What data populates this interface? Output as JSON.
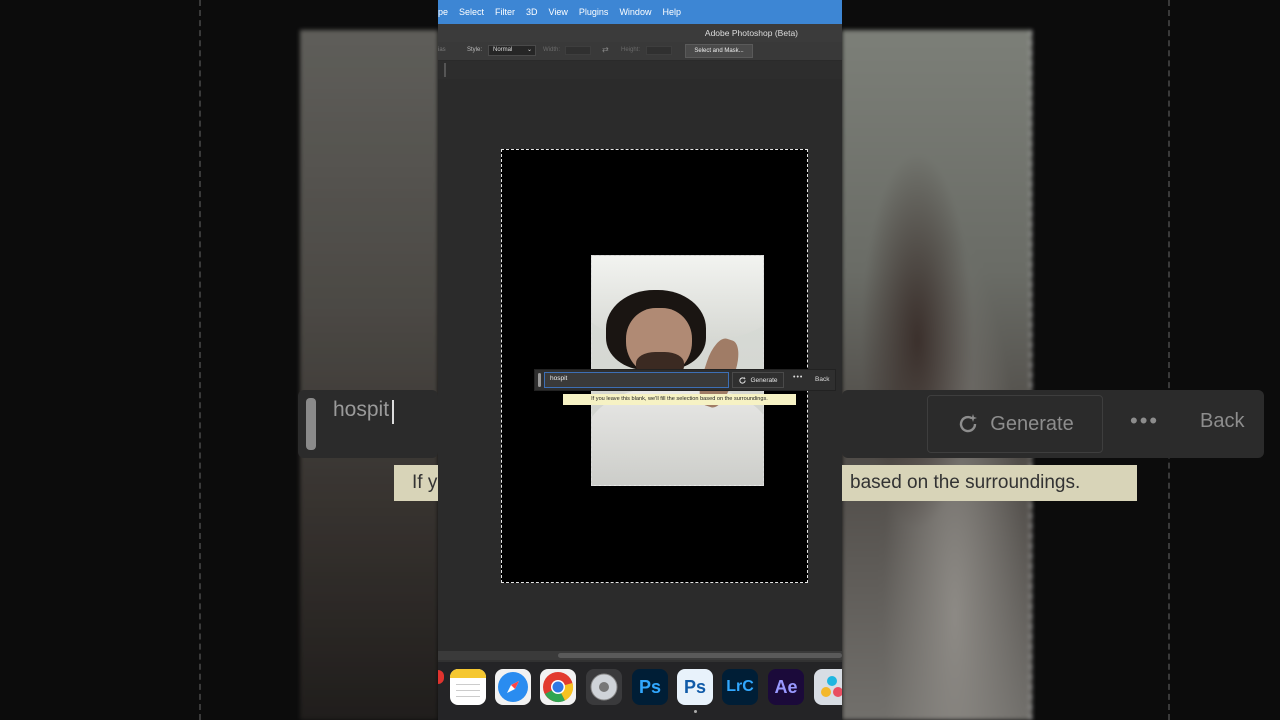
{
  "menubar": {
    "items": [
      "pe",
      "Select",
      "Filter",
      "3D",
      "View",
      "Plugins",
      "Window",
      "Help"
    ]
  },
  "window": {
    "title": "Adobe Photoshop (Beta)"
  },
  "options": {
    "partial_label": "ias",
    "style_label": "Style:",
    "style_value": "Normal",
    "width_label": "Width:",
    "height_label": "Height:",
    "select_mask_label": "Select and Mask..."
  },
  "generative_bar": {
    "prompt_value": "hospit",
    "generate_label": "Generate",
    "more_label": "•••",
    "back_label": "Back",
    "tooltip": "If you leave this blank, we'll fill the selection based on the surroundings."
  },
  "zoomed_background": {
    "prompt_text": "hospit",
    "generate_text": "Generate",
    "dots_text": "•••",
    "back_text": "Back",
    "tooltip_left_fragment": "If y",
    "tooltip_right_fragment": "based on the surroundings."
  },
  "dock": {
    "apps": [
      {
        "name": "notes",
        "label": ""
      },
      {
        "name": "safari",
        "label": ""
      },
      {
        "name": "chrome",
        "label": ""
      },
      {
        "name": "compressor",
        "label": ""
      },
      {
        "name": "photoshop",
        "label": "Ps"
      },
      {
        "name": "photoshop-beta",
        "label": "Ps"
      },
      {
        "name": "lightroom-classic",
        "label": "LrC"
      },
      {
        "name": "after-effects",
        "label": "Ae"
      },
      {
        "name": "davinci-resolve",
        "label": ""
      }
    ]
  },
  "colors": {
    "menubar_bg": "#3d86d4",
    "ps_blue": "#31a8ff",
    "ae_purple": "#9999ff",
    "tooltip_bg": "#f6f2c4"
  }
}
